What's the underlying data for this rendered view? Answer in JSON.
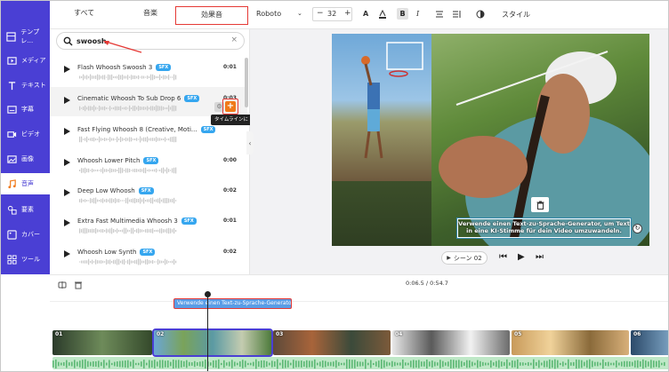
{
  "sidebar": {
    "items": [
      {
        "label": "テンプレ…",
        "icon": "template-icon"
      },
      {
        "label": "メディア",
        "icon": "media-icon"
      },
      {
        "label": "テキスト",
        "icon": "text-icon"
      },
      {
        "label": "字幕",
        "icon": "subtitle-icon"
      },
      {
        "label": "ビデオ",
        "icon": "video-icon"
      },
      {
        "label": "画像",
        "icon": "image-icon"
      },
      {
        "label": "音声",
        "icon": "music-icon"
      },
      {
        "label": "要素",
        "icon": "elements-icon"
      },
      {
        "label": "カバー",
        "icon": "cover-icon"
      },
      {
        "label": "ツール",
        "icon": "tools-icon"
      }
    ],
    "active_index": 6
  },
  "tabs": {
    "all": "すべて",
    "music": "音楽",
    "sfx": "効果音"
  },
  "toolbar": {
    "font": "Roboto",
    "minus": "−",
    "size": "32",
    "plus": "+",
    "bold": "B",
    "italic": "I",
    "style": "スタイル"
  },
  "search": {
    "value": "swoosh",
    "clear": "×"
  },
  "sounds": [
    {
      "title": "Flash Whoosh Swoosh 3",
      "badge": "SFX",
      "duration": "0:01"
    },
    {
      "title": "Cinematic Whoosh To Sub Drop 6",
      "badge": "SFX",
      "duration": "0:03"
    },
    {
      "title": "Fast Flying Whoosh 8 (Creative, Moti...",
      "badge": "SFX",
      "duration": ""
    },
    {
      "title": "Whoosh Lower Pitch",
      "badge": "SFX",
      "duration": "0:00"
    },
    {
      "title": "Deep Low Whoosh",
      "badge": "SFX",
      "duration": "0:02"
    },
    {
      "title": "Extra Fast Multimedia Whoosh 3",
      "badge": "SFX",
      "duration": "0:01"
    },
    {
      "title": "Whoosh Low Synth",
      "badge": "SFX",
      "duration": "0:02"
    }
  ],
  "hover": {
    "add_label": "+",
    "tooltip": "タイムラインに"
  },
  "preview": {
    "caption": "Verwende einen Text-zu-Sprache-Generator, um Text in eine KI-Stimme für dein Video umzuwandeln.",
    "scene_label": "シーン 02"
  },
  "timeline": {
    "time": "0:06.5 / 0:54.7",
    "text_clip": "Verwende einen Text-zu-Sprache-Generator, ...",
    "scenes": [
      "01",
      "02",
      "03",
      "04",
      "05",
      "06"
    ]
  },
  "colors": {
    "sidebar": "#4a3fd4",
    "badge": "#35a6ef",
    "highlight": "#e53935",
    "add_button": "#f07a1a",
    "audio_track": "#bfe8c7"
  }
}
